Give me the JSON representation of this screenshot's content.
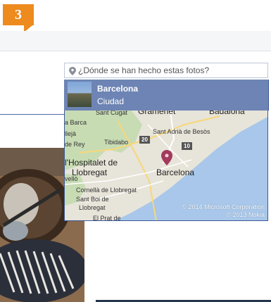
{
  "step": {
    "number": "3"
  },
  "search": {
    "placeholder": "¿Dónde se han hecho estas fotos?",
    "icon": "location-pin-icon"
  },
  "suggestion": {
    "title": "Barcelona",
    "subtitle": "Ciudad"
  },
  "map": {
    "labels": {
      "sant_cugat": "Sant Cugat",
      "gramenet": "Gramenet",
      "badalona": "Badalona",
      "la_barca": "a Barca",
      "llejà": "llejà",
      "desvern": "de Rey",
      "tibidabo": "Tibidabo",
      "sant_adria": "Sant Adrià de Besòs",
      "hospitalet_1": "l'Hospitalet de",
      "hospitalet_2": "Llobregat",
      "barcelona": "Barcelona",
      "vello": "vellò",
      "cornella": "Cornellà de Llobregat",
      "sant_boi_1": "Sant Boi de",
      "sant_boi_2": "Llobregat",
      "el_prat": "El Prat de"
    },
    "roads": {
      "r1": "20",
      "r2": "10"
    },
    "copyright_1": "© 2014 Microsoft Corporation",
    "copyright_2": "© 2013 Nokia"
  },
  "colors": {
    "accent": "#ed8b1f",
    "selection": "#6d84b4",
    "brand": "#3b5998",
    "map_land": "#e7e4d9",
    "map_water": "#a8c7ea",
    "map_park": "#c8dcb4"
  }
}
